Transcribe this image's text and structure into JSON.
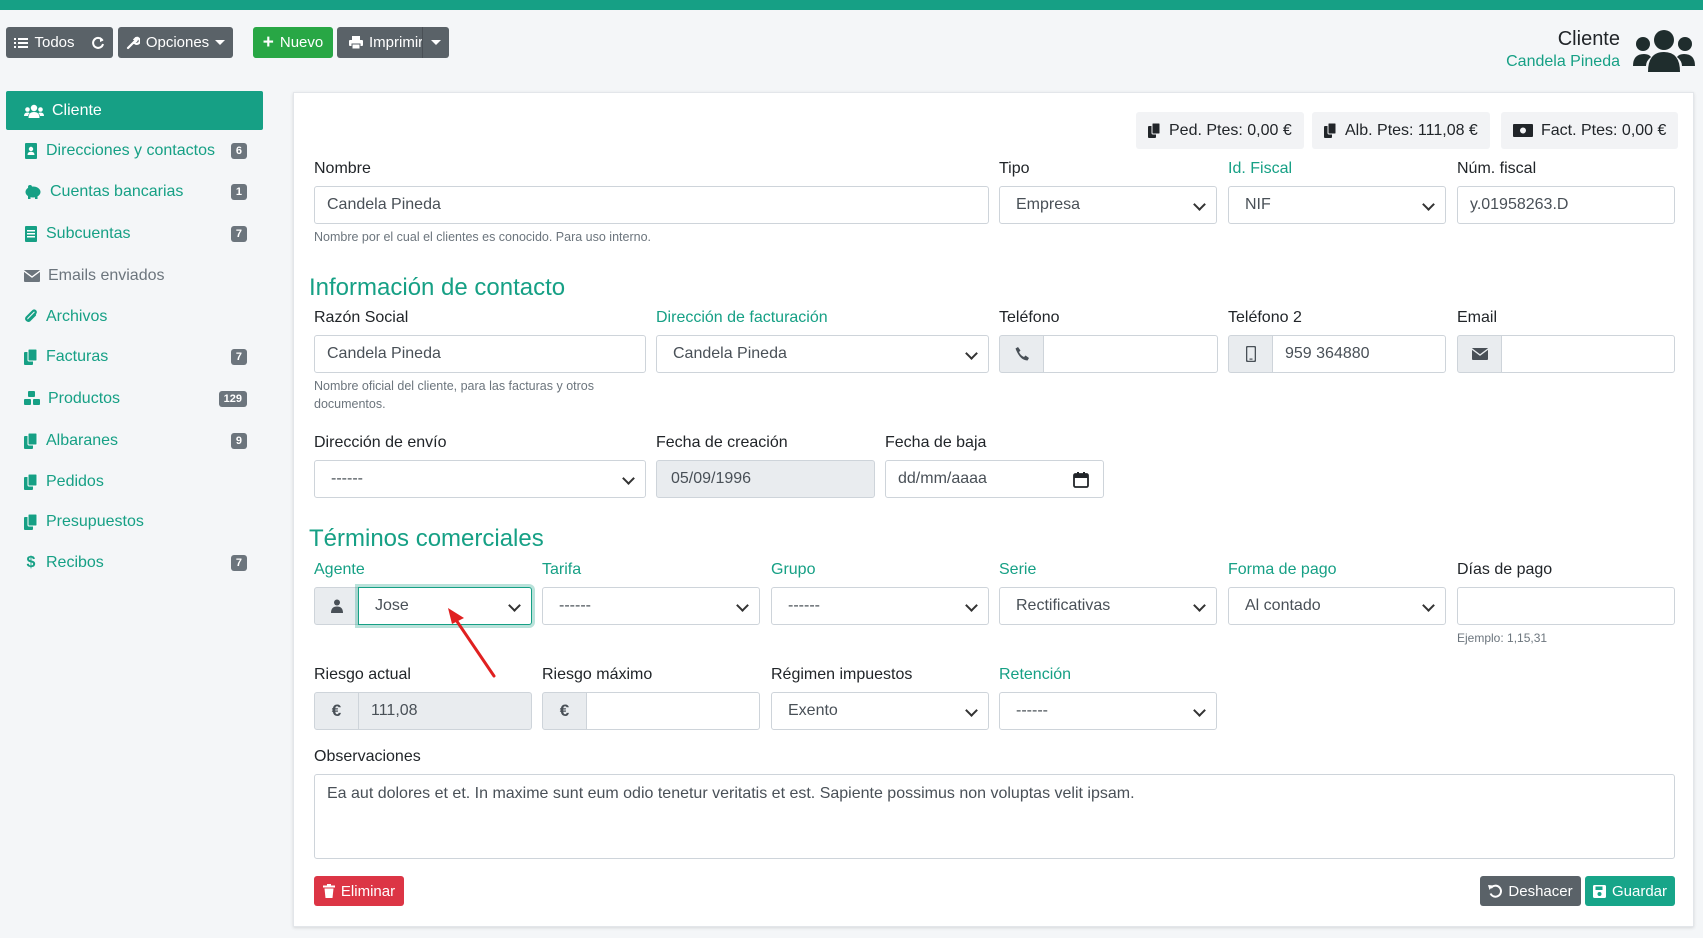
{
  "toolbar": {
    "all_label": "Todos",
    "options_label": "Opciones",
    "new_label": "Nuevo",
    "print_label": "Imprimir"
  },
  "header": {
    "title": "Cliente",
    "subtitle": "Candela Pineda"
  },
  "sidebar": {
    "items": [
      {
        "label": "Cliente",
        "icon": "users-icon",
        "badge": ""
      },
      {
        "label": "Direcciones y contactos",
        "icon": "address-book-icon",
        "badge": "6"
      },
      {
        "label": "Cuentas bancarias",
        "icon": "piggy-bank-icon",
        "badge": "1"
      },
      {
        "label": "Subcuentas",
        "icon": "book-icon",
        "badge": "7"
      },
      {
        "label": "Emails enviados",
        "icon": "envelope-icon",
        "badge": ""
      },
      {
        "label": "Archivos",
        "icon": "paperclip-icon",
        "badge": ""
      },
      {
        "label": "Facturas",
        "icon": "copy-icon",
        "badge": "7"
      },
      {
        "label": "Productos",
        "icon": "cubes-icon",
        "badge": "129"
      },
      {
        "label": "Albaranes",
        "icon": "copy-icon",
        "badge": "9"
      },
      {
        "label": "Pedidos",
        "icon": "copy-icon",
        "badge": ""
      },
      {
        "label": "Presupuestos",
        "icon": "copy-icon",
        "badge": ""
      },
      {
        "label": "Recibos",
        "icon": "dollar-icon",
        "badge": "7"
      }
    ]
  },
  "pending": {
    "orders": "Ped. Ptes: 0,00 €",
    "delivery": "Alb. Ptes: 111,08 €",
    "invoices": "Fact. Ptes: 0,00 €"
  },
  "form": {
    "nombre_label": "Nombre",
    "nombre_value": "Candela Pineda",
    "nombre_help": "Nombre por el cual el clientes es conocido. Para uso interno.",
    "tipo_label": "Tipo",
    "tipo_value": "Empresa",
    "idfiscal_label": "Id. Fiscal",
    "idfiscal_value": "NIF",
    "numfiscal_label": "Núm. fiscal",
    "numfiscal_value": "y.01958263.D",
    "contact_heading": "Información de contacto",
    "razon_label": "Razón Social",
    "razon_value": "Candela Pineda",
    "razon_help_1": "Nombre oficial del cliente, para las facturas y otros",
    "razon_help_2": "documentos.",
    "dirfact_label": "Dirección de facturación",
    "dirfact_value": "Candela Pineda",
    "telefono_label": "Teléfono",
    "telefono_value": "",
    "telefono2_label": "Teléfono 2",
    "telefono2_value": "959 364880",
    "email_label": "Email",
    "email_value": "",
    "direnvio_label": "Dirección de envío",
    "direnvio_value": "------",
    "fechacrea_label": "Fecha de creación",
    "fechacrea_value": "05/09/1996",
    "fechabaja_label": "Fecha de baja",
    "fechabaja_placeholder": "dd/mm/aaaa",
    "terms_heading": "Términos comerciales",
    "agente_label": "Agente",
    "agente_value": "Jose",
    "tarifa_label": "Tarifa",
    "tarifa_value": "------",
    "grupo_label": "Grupo",
    "grupo_value": "------",
    "serie_label": "Serie",
    "serie_value": "Rectificativas",
    "formapago_label": "Forma de pago",
    "formapago_value": "Al contado",
    "diaspago_label": "Días de pago",
    "diaspago_value": "",
    "diaspago_help": "Ejemplo: 1,15,31",
    "riesgo_label": "Riesgo actual",
    "riesgo_value": "111,08",
    "riesgomax_label": "Riesgo máximo",
    "riesgomax_value": "",
    "regimen_label": "Régimen impuestos",
    "regimen_value": "Exento",
    "retencion_label": "Retención",
    "retencion_value": "------",
    "currency_symbol": "€",
    "obs_label": "Observaciones",
    "obs_value": "Ea aut dolores et et. In maxime sunt eum odio tenetur veritatis et est. Sapiente possimus non voluptas velit ipsam."
  },
  "actions": {
    "delete_label": "Eliminar",
    "undo_label": "Deshacer",
    "save_label": "Guardar"
  },
  "colors": {
    "accent": "#16a085",
    "danger": "#dc3545",
    "success": "#28a745",
    "annotation_arrow": "#e02020"
  }
}
